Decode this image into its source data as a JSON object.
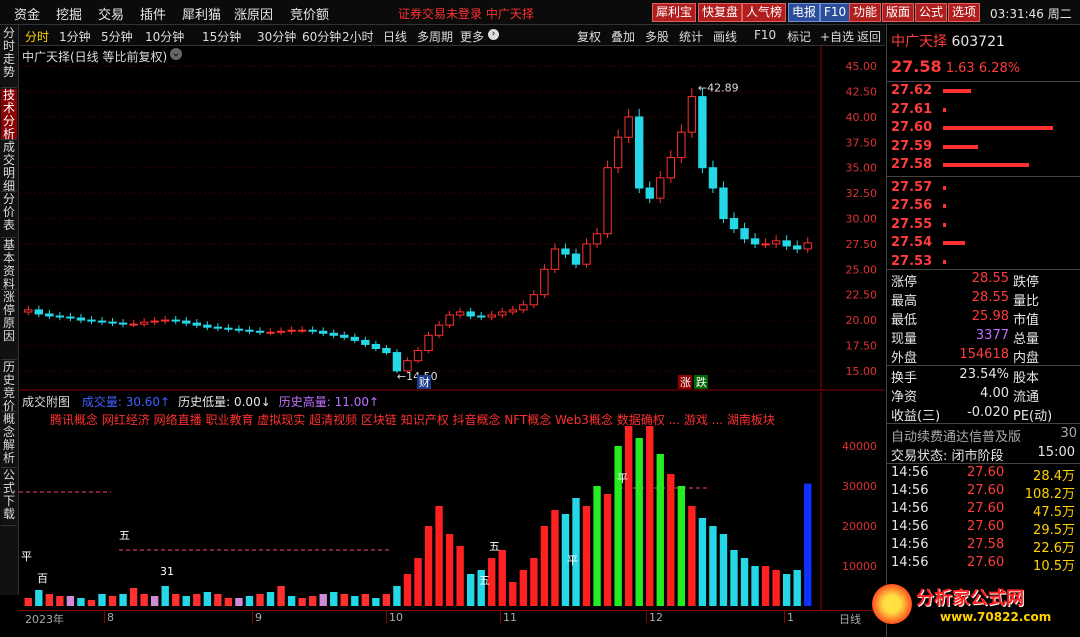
{
  "menu": [
    "资金",
    "挖掘",
    "交易",
    "插件",
    "犀利猫",
    "涨原因",
    "竞价额"
  ],
  "warning": "证券交易未登录  中广天择",
  "toolbar_buttons": [
    {
      "label": "犀利宝",
      "style": "red"
    },
    {
      "label": "快复盘",
      "style": "red"
    },
    {
      "label": "人气榜",
      "style": "red"
    },
    {
      "label": "电报",
      "style": "blue"
    },
    {
      "label": "F10",
      "style": "blue"
    },
    {
      "label": "功能",
      "style": "red"
    },
    {
      "label": "版面",
      "style": "red"
    },
    {
      "label": "公式",
      "style": "red"
    },
    {
      "label": "选项",
      "style": "red"
    }
  ],
  "clock": "03:31:46 周二",
  "sidebar": [
    "分时走势",
    "技术分析",
    "成交明细",
    "分价表",
    "基本资料",
    "涨停原因",
    "历史竞价",
    "概念解析",
    "公式下载"
  ],
  "periods": [
    "分时",
    "1分钟",
    "5分钟",
    "10分钟",
    "15分钟",
    "30分钟",
    "60分钟",
    "2小时",
    "日线",
    "多周期",
    "更多"
  ],
  "active_period": "分时",
  "chart_tools": [
    "复权",
    "叠加",
    "多股",
    "统计",
    "画线",
    "F10",
    "标记",
    "+自选",
    "返回"
  ],
  "chart_title": "中广天择(日线 等比前复权)",
  "high_marker": "42.89",
  "low_marker": "14.50",
  "marks": {
    "cai": "财",
    "zhang": "涨",
    "die": "跌"
  },
  "main_yaxis": [
    "45.00",
    "42.50",
    "40.00",
    "37.50",
    "35.00",
    "32.50",
    "30.00",
    "27.50",
    "25.00",
    "22.50",
    "20.00",
    "17.50",
    "15.00"
  ],
  "sub_title": "成交附图",
  "sub_legend": [
    {
      "label": "成交量: 30.60↑",
      "color": "#4060ff"
    },
    {
      "label": "历史低量: 0.00↓",
      "color": "#e6e6e6"
    },
    {
      "label": "历史高量: 11.00↑",
      "color": "#c070ff"
    }
  ],
  "concepts": "腾讯概念 网红经济 网络直播 职业教育 虚拟现实 超清视频 区块链 知识产权 抖音概念 NFT概念 Web3概念 数据确权 ... 游戏 ... 湖南板块",
  "sub_yaxis": [
    "40000",
    "30000",
    "20000",
    "10000"
  ],
  "xaxis_labels": [
    "2023年",
    "8",
    "9",
    "10",
    "11",
    "12",
    "1"
  ],
  "xaxis_tail": "日线",
  "sub_bar_labels": [
    "平",
    "五",
    "百",
    "31",
    "五",
    "平",
    "五",
    "平"
  ],
  "chart_data": {
    "type": "candlestick",
    "title": "中广天择(日线 等比前复权)",
    "ylim": [
      14,
      46
    ],
    "candles_close_approx": [
      21.0,
      20.6,
      20.4,
      20.3,
      20.2,
      20.0,
      19.9,
      19.8,
      19.7,
      19.6,
      19.6,
      19.8,
      19.9,
      20.0,
      19.9,
      19.7,
      19.5,
      19.3,
      19.2,
      19.1,
      19.0,
      18.9,
      18.8,
      18.8,
      18.9,
      19.0,
      19.0,
      18.9,
      18.7,
      18.5,
      18.3,
      18.0,
      17.6,
      17.2,
      16.8,
      15.0,
      16.0,
      17.0,
      18.5,
      19.5,
      20.5,
      20.8,
      20.4,
      20.3,
      20.5,
      20.8,
      21.0,
      21.5,
      22.5,
      25.0,
      27.0,
      26.5,
      25.5,
      27.5,
      28.5,
      35.0,
      38.0,
      40.0,
      33.0,
      32.0,
      34.0,
      36.0,
      38.5,
      42.0,
      35.0,
      33.0,
      30.0,
      29.0,
      28.0,
      27.5,
      27.5,
      27.8,
      27.3,
      27.0,
      27.6
    ],
    "volume_approx": [
      2000,
      4000,
      3000,
      2500,
      2500,
      2000,
      1500,
      3000,
      2500,
      3000,
      4500,
      3000,
      2500,
      5000,
      3000,
      2500,
      3000,
      3500,
      3000,
      2000,
      2000,
      2500,
      3000,
      3500,
      5000,
      2500,
      2000,
      2500,
      3000,
      3500,
      3000,
      2500,
      3000,
      2000,
      3000,
      5000,
      8000,
      12000,
      20000,
      25000,
      18000,
      15000,
      8000,
      9000,
      12000,
      14000,
      6000,
      9000,
      12000,
      20000,
      24000,
      23000,
      27000,
      25000,
      30000,
      28000,
      40000,
      45000,
      42000,
      45000,
      38000,
      33000,
      30000,
      25000,
      22000,
      20000,
      18000,
      14000,
      12000,
      10000,
      10000,
      9000,
      8000,
      9000,
      30600
    ],
    "series": [
      {
        "name": "成交量",
        "values": []
      }
    ]
  },
  "quote": {
    "name": "中广天择",
    "code": "603721",
    "price": "27.58",
    "change": "1.63",
    "pct": "6.28%"
  },
  "order_book": [
    {
      "price": "27.62",
      "bar": 0.25
    },
    {
      "price": "27.61",
      "bar": 0.02
    },
    {
      "price": "27.60",
      "bar": 1.0
    },
    {
      "price": "27.59",
      "bar": 0.32
    },
    {
      "price": "27.58",
      "bar": 0.78
    },
    {
      "price": "27.57",
      "bar": 0.02
    },
    {
      "price": "27.56",
      "bar": 0.02
    },
    {
      "price": "27.55",
      "bar": 0.02
    },
    {
      "price": "27.54",
      "bar": 0.2
    },
    {
      "price": "27.53",
      "bar": 0.02
    }
  ],
  "stats": [
    {
      "l1": "涨停",
      "v1": "28.55",
      "c1": "red",
      "l2": "跌停"
    },
    {
      "l1": "最高",
      "v1": "28.55",
      "c1": "red",
      "l2": "量比"
    },
    {
      "l1": "最低",
      "v1": "25.98",
      "c1": "red",
      "l2": "市值"
    },
    {
      "l1": "现量",
      "v1": "3377",
      "c1": "purple",
      "l2": "总量"
    },
    {
      "l1": "外盘",
      "v1": "154618",
      "c1": "red",
      "l2": "内盘"
    }
  ],
  "stats2": [
    {
      "l1": "换手",
      "v1": "23.54%",
      "c1": "white",
      "l2": "股本"
    },
    {
      "l1": "净资",
      "v1": "4.00",
      "c1": "white",
      "l2": "流通"
    },
    {
      "l1": "收益(三)",
      "v1": "-0.020",
      "c1": "white",
      "l2": "PE(动)"
    }
  ],
  "news": "自动续费通达信普及版",
  "news_tail": "30",
  "trade_state": "交易状态: 闭市阶段",
  "trade_time": "15:00",
  "ticks": [
    {
      "t": "14:56",
      "p": "27.60",
      "v": "28.4万"
    },
    {
      "t": "14:56",
      "p": "27.60",
      "v": "108.2万"
    },
    {
      "t": "14:56",
      "p": "27.60",
      "v": "47.5万"
    },
    {
      "t": "14:56",
      "p": "27.60",
      "v": "29.5万"
    },
    {
      "t": "14:56",
      "p": "27.58",
      "v": "22.6万"
    },
    {
      "t": "14:56",
      "p": "27.60",
      "v": "10.5万"
    }
  ],
  "logo_text": "分析家公式网",
  "logo_url": "www.70822.com"
}
